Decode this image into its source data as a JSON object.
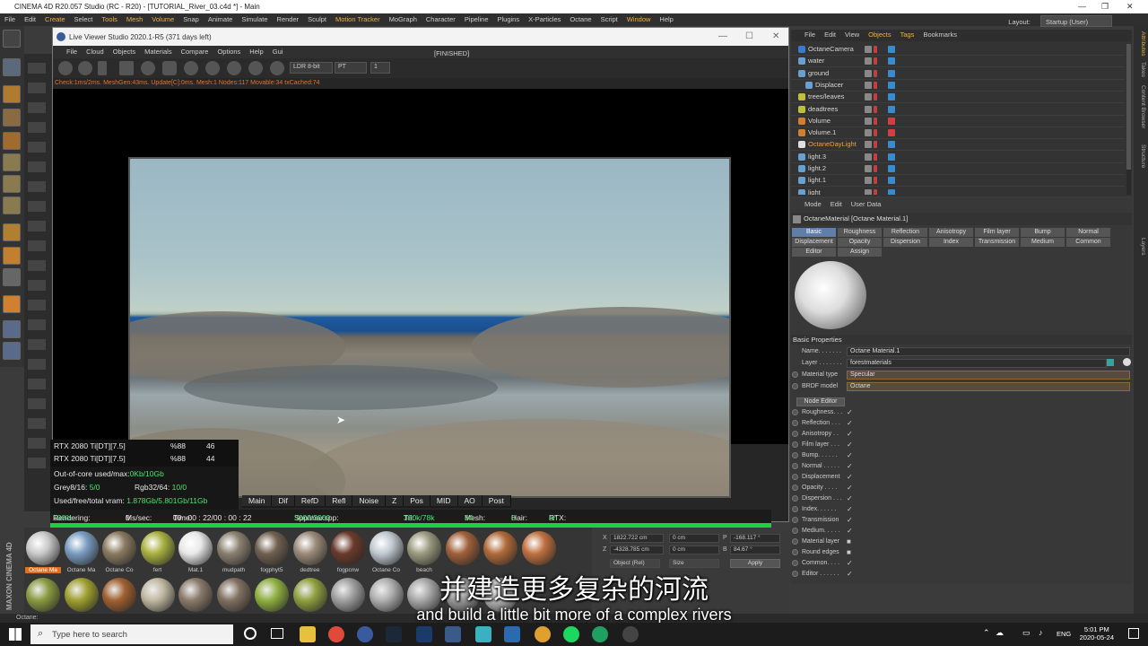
{
  "window": {
    "title": "CINEMA 4D R20.057 Studio (RC - R20) - [TUTORIAL_River_03.c4d *] - Main"
  },
  "menubar": {
    "items": [
      "File",
      "Edit",
      "Create",
      "Select",
      "Tools",
      "Mesh",
      "Volume",
      "Snap",
      "Animate",
      "Simulate",
      "Render",
      "Sculpt",
      "Motion Tracker",
      "MoGraph",
      "Character",
      "Pipeline",
      "Plugins",
      "X-Particles",
      "Octane",
      "Script",
      "Window",
      "Help"
    ],
    "layout_label": "Layout:",
    "layout_value": "Startup (User)"
  },
  "live_viewer": {
    "title": "Live Viewer Studio 2020.1-R5 (371 days left)",
    "menu": [
      "File",
      "Cloud",
      "Objects",
      "Materials",
      "Compare",
      "Options",
      "Help",
      "Gui"
    ],
    "status_label": "[FINISHED]",
    "depth_select": "LDR 8-bit",
    "kernel_select": "PT",
    "count_value": "1",
    "status_line": "Check:1ms/2ms. MeshGen:43ms. Update[C]:0ms. Mesh:1 Nodes:117 Movable:34 txCached:74"
  },
  "gpu": [
    {
      "name": "RTX 2080 Ti[DT][7.5]",
      "percent": "%88",
      "value": "46"
    },
    {
      "name": "RTX 2080 Ti[DT][7.5]",
      "percent": "%88",
      "value": "44"
    }
  ],
  "memory": {
    "outofcore_label": "Out-of-core used/max:",
    "outofcore_value": "0Kb/10Gb",
    "grey_label": "Grey8/16:",
    "grey_value": "5/0",
    "rgb_label": "Rgb32/64:",
    "rgb_value": "10/0",
    "vram_label": "Used/free/total vram:",
    "vram_value": "1.878Gb/5.801Gb/11Gb"
  },
  "passes": [
    "Main",
    "Dif",
    "RefD",
    "Refl",
    "Noise",
    "Z",
    "Pos",
    "MID",
    "AO",
    "Post"
  ],
  "rendering": {
    "label": "Rendering:",
    "percent": "100%",
    "ms_label": "Ms/sec:",
    "ms_value": "0",
    "time_label": "Time:",
    "time_value": "00 : 00 : 22/00 : 00 : 22",
    "spp_label": "Spp/maxspp:",
    "spp_value": "3000/3000",
    "tri_label": "Tri:",
    "tri_value": "320k/78k",
    "mesh_label": "Mesh:",
    "mesh_value": "34",
    "hair_label": "Hair:",
    "hair_value": "0",
    "rtx_label": "RTX:",
    "rtx_value": "on",
    "progress": 1.0
  },
  "materials": [
    {
      "label": "Octane Ma",
      "color": "#c9c9c9"
    },
    {
      "label": "Octane Ma",
      "color": "#7a9cc0"
    },
    {
      "label": "Octane Co",
      "color": "#8a7a60"
    },
    {
      "label": "fert",
      "color": "#a8b040"
    },
    {
      "label": "Mat.1",
      "color": "#e8e8e8"
    },
    {
      "label": "mudpath",
      "color": "#8a8070"
    },
    {
      "label": "fogphyt5",
      "color": "#706050"
    },
    {
      "label": "dedtree",
      "color": "#9a8a78"
    },
    {
      "label": "fogpcnw",
      "color": "#6a3a2a"
    },
    {
      "label": "Octane Co",
      "color": "#c0c8d0"
    },
    {
      "label": "beach",
      "color": "#9a9a80"
    },
    {
      "label": "",
      "color": "#a0603a"
    },
    {
      "label": "",
      "color": "#b06a3a"
    },
    {
      "label": "",
      "color": "#c07040"
    }
  ],
  "materials_row2": [
    "#8a9a40",
    "#a0a030",
    "#a06030",
    "#c0b8a0",
    "#8a7a6a",
    "#807060",
    "#90b040",
    "#90a040",
    "#a0a0a0",
    "#b0b0b0",
    "#a8a8a8",
    "#9a9a9a",
    "#b8b8b8"
  ],
  "coords": {
    "x_pos": "1822.722 cm",
    "y_pos": "0 cm",
    "p_rot": "-168.117 °",
    "z_pos": "-4328.785 cm",
    "z_size": "0 cm",
    "b_rot": "84.67 °",
    "mode_select": "Object (Rel)",
    "size_select": "Size",
    "apply_label": "Apply",
    "x_label": "X",
    "z_label": "Z",
    "p_label": "P",
    "b_label": "B"
  },
  "objects_menu": [
    "File",
    "Edit",
    "View",
    "Objects",
    "Tags",
    "Bookmarks"
  ],
  "objects": [
    {
      "name": "OctaneCamera",
      "icon_color": "#3a7ad0"
    },
    {
      "name": "water",
      "icon_color": "#6aa0d0"
    },
    {
      "name": "ground",
      "icon_color": "#6aa0d0"
    },
    {
      "name": "Displacer",
      "icon_color": "#6aa0d0"
    },
    {
      "name": "trees/leaves",
      "icon_color": "#c0c040"
    },
    {
      "name": "deadtrees",
      "icon_color": "#c0c040"
    },
    {
      "name": "Volume",
      "icon_color": "#d08030"
    },
    {
      "name": "Volume.1",
      "icon_color": "#d08030"
    },
    {
      "name": "OctaneDayLight",
      "icon_color": "#e0e0e0",
      "highlight": true
    },
    {
      "name": "light.3",
      "icon_color": "#6aa0d0"
    },
    {
      "name": "light.2",
      "icon_color": "#6aa0d0"
    },
    {
      "name": "light.1",
      "icon_color": "#6aa0d0"
    },
    {
      "name": "light",
      "icon_color": "#6aa0d0"
    }
  ],
  "attributes": {
    "menu": [
      "Mode",
      "Edit",
      "User Data"
    ],
    "header": "OctaneMaterial [Octane Material.1]",
    "tabs_row1": [
      "Basic",
      "Roughness",
      "Reflection",
      "Anisotropy",
      "Film layer",
      "Bump",
      "Normal"
    ],
    "tabs_row2": [
      "Displacement",
      "Opacity",
      "Dispersion",
      "Index",
      "Transmission",
      "Medium",
      "Common"
    ],
    "tabs_row3": [
      "Editor",
      "Assign"
    ],
    "section": "Basic Properties",
    "name_label": "Name. . . . . . .",
    "name_value": "Octane Material.1",
    "layer_label": "Layer . . . . . . .",
    "layer_value": "forestmaterials",
    "mat_type_label": "Material type",
    "mat_type_value": "Specular",
    "brdf_label": "BRDF model",
    "brdf_value": "Octane",
    "node_editor": "Node Editor",
    "channels": [
      {
        "label": "Roughness. . .",
        "check": "✓"
      },
      {
        "label": "Reflection . . .",
        "check": "✓"
      },
      {
        "label": "Anisotropy . .",
        "check": "✓"
      },
      {
        "label": "Film layer . . .",
        "check": "✓"
      },
      {
        "label": "Bump. . . . . .",
        "check": "✓"
      },
      {
        "label": "Normal . . . . .",
        "check": "✓"
      },
      {
        "label": "Displacement",
        "check": "✓"
      },
      {
        "label": "Opacity . . . .",
        "check": "✓"
      },
      {
        "label": "Dispersion . . .",
        "check": "✓"
      },
      {
        "label": "Index. . . . . .",
        "check": "✓"
      },
      {
        "label": "Transmission",
        "check": "✓"
      },
      {
        "label": "Medium. . . . .",
        "check": "✓"
      },
      {
        "label": "Material layer",
        "check": "■"
      },
      {
        "label": "Round edges",
        "check": "■"
      },
      {
        "label": "Common. . . .",
        "check": "✓"
      },
      {
        "label": "Editor . . . . . .",
        "check": "✓"
      }
    ]
  },
  "right_tabs": [
    "Attributes",
    "Takes",
    "Content Browser",
    "Structure",
    "Layers"
  ],
  "left_strip_label": "MAXON CINEMA 4D",
  "status_bar": "Octane:",
  "subtitle": {
    "cn": "并建造更多复杂的河流",
    "en": "and build a little bit more of a complex rivers"
  },
  "taskbar": {
    "search_placeholder": "Type here to search",
    "lang": "ENG",
    "time": "5:01 PM",
    "date": "2020-05-24"
  }
}
